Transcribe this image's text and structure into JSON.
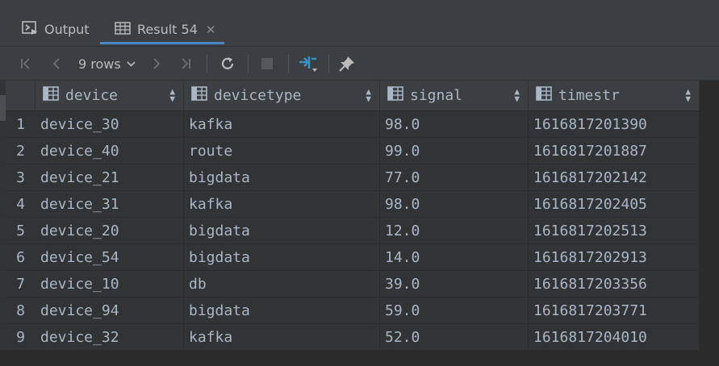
{
  "tabs": [
    {
      "label": "Output",
      "icon": "console-run-icon"
    },
    {
      "label": "Result 54",
      "icon": "table-icon",
      "close": "✕"
    }
  ],
  "toolbar": {
    "rows_label": "9 rows",
    "icons": [
      "first-page-icon",
      "prev-page-icon",
      "next-page-icon",
      "last-page-icon",
      "refresh-icon",
      "stop-icon",
      "compare-icon",
      "pin-icon"
    ]
  },
  "table": {
    "columns": [
      "device",
      "devicetype",
      "signal",
      "timestr"
    ],
    "rows": [
      {
        "num": "1",
        "cells": [
          "device_30",
          "kafka",
          "98.0",
          "1616817201390"
        ]
      },
      {
        "num": "2",
        "cells": [
          "device_40",
          "route",
          "99.0",
          "1616817201887"
        ]
      },
      {
        "num": "3",
        "cells": [
          "device_21",
          "bigdata",
          "77.0",
          "1616817202142"
        ]
      },
      {
        "num": "4",
        "cells": [
          "device_31",
          "kafka",
          "98.0",
          "1616817202405"
        ]
      },
      {
        "num": "5",
        "cells": [
          "device_20",
          "bigdata",
          "12.0",
          "1616817202513"
        ]
      },
      {
        "num": "6",
        "cells": [
          "device_54",
          "bigdata",
          "14.0",
          "1616817202913"
        ]
      },
      {
        "num": "7",
        "cells": [
          "device_10",
          "db",
          "39.0",
          "1616817203356"
        ]
      },
      {
        "num": "8",
        "cells": [
          "device_94",
          "bigdata",
          "59.0",
          "1616817203771"
        ]
      },
      {
        "num": "9",
        "cells": [
          "device_32",
          "kafka",
          "52.0",
          "1616817204010"
        ]
      }
    ]
  },
  "colors": {
    "accent": "#4a88c7",
    "compare_icon": "#3592c4",
    "text": "#a9b7c6"
  }
}
